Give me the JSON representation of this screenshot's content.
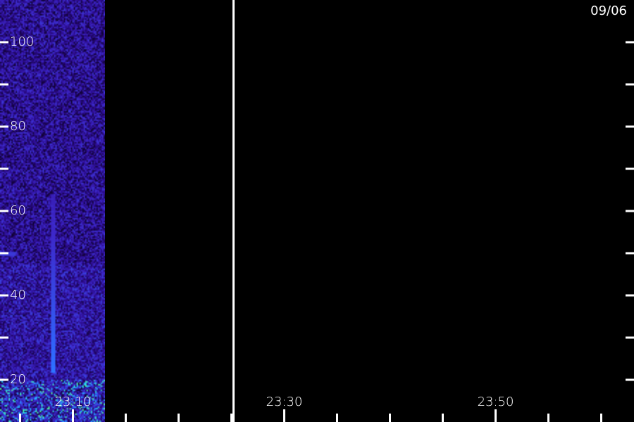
{
  "chart_data": {
    "type": "heatmap",
    "title": "",
    "date_label": "09/06",
    "xlabel": "",
    "ylabel": "",
    "x_tick_labels": [
      "23:10",
      "23:30",
      "23:50"
    ],
    "x_tick_times_min": [
      70,
      90,
      110
    ],
    "x_range_min": [
      63.1,
      123.1
    ],
    "x_minor_step_min": 5,
    "y_tick_labels": [
      "20",
      "40",
      "60",
      "80",
      "100"
    ],
    "y_tick_values": [
      20,
      40,
      60,
      80,
      100
    ],
    "y_range": [
      10,
      110
    ],
    "y_minor_step": 10,
    "data_end_time_min": 73.0,
    "marker_line_time_min": 85.2,
    "colormap": [
      "#0b0020",
      "#2a0a8a",
      "#3d27c9",
      "#2f6bff",
      "#20c8ff",
      "#5cff8a"
    ],
    "features": [
      {
        "kind": "vertical-streak",
        "time_min": 68.0,
        "y_from": 22,
        "y_to": 64
      },
      {
        "kind": "horizontal-line",
        "y": 50,
        "time_from": 63.1,
        "time_to": 64.5
      },
      {
        "kind": "low-band",
        "y_from": 10,
        "y_to": 20
      }
    ]
  }
}
